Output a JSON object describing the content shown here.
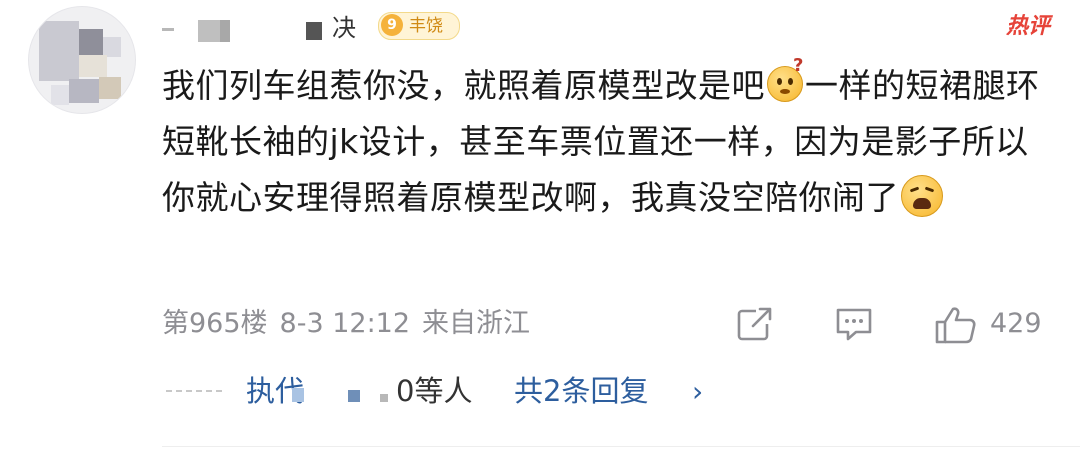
{
  "user": {
    "name_visible": "…",
    "name_tail": "决",
    "level": "9",
    "level_label": "丰饶"
  },
  "hot_tag": "热评",
  "comment": {
    "text_part1": "我们列车组惹你没，就照着原模型改是吧",
    "emoji1": "thinking-face-emoji",
    "text_part2": "一样的短裙腿环短靴长袖的jk设计，甚至车票位置还一样，因为是影子所以你就心安理得照着原模型改啊，我真没空陪你闹了",
    "emoji2": "weary-face-emoji"
  },
  "meta": {
    "floor": "第965楼",
    "time": "8-3 12:12",
    "location": "来自浙江",
    "like_count": "429"
  },
  "replies": {
    "name_visible": "执代",
    "count_visible": "0等人",
    "link": "共2条回复",
    "chevron": "›"
  },
  "colors": {
    "hot": "#e64339",
    "link": "#2d5e9e",
    "meta": "#8e8e93",
    "badge": "#f5b23b"
  }
}
